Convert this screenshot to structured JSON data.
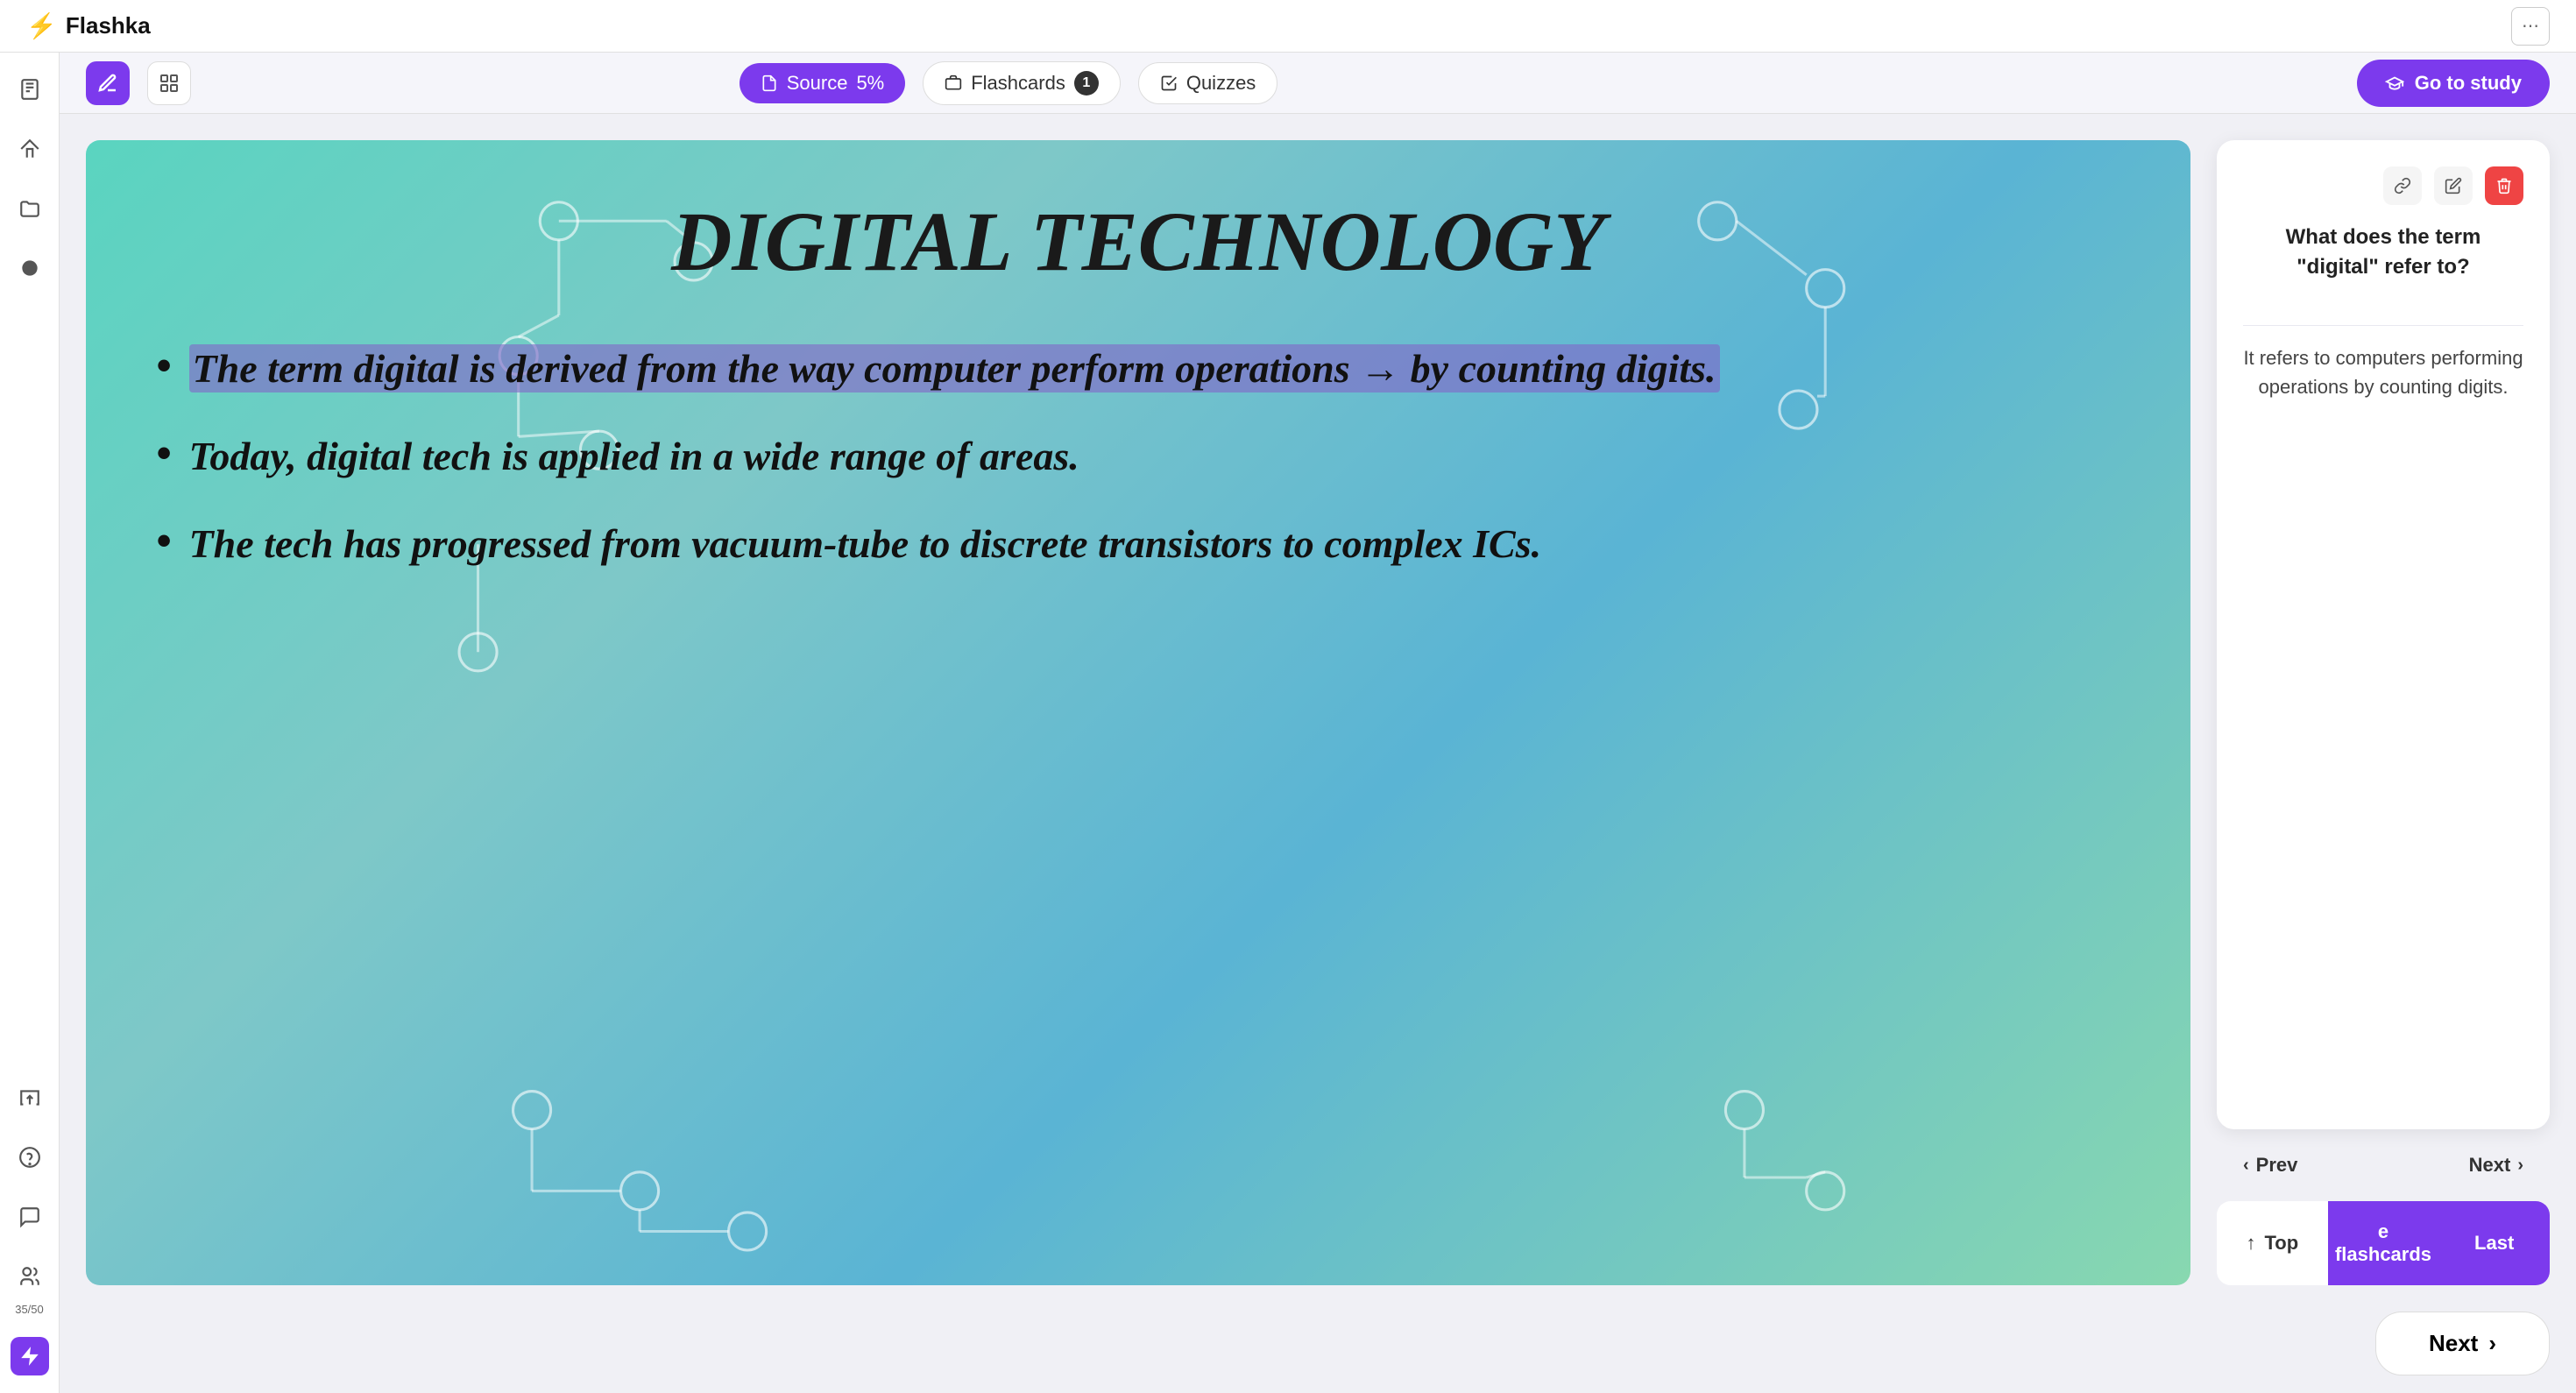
{
  "app": {
    "name": "Flashka",
    "logo_icon": "⚡"
  },
  "topbar": {
    "chat_icon": "💬"
  },
  "sidebar": {
    "items": [
      {
        "icon": "📄",
        "label": "document",
        "active": false
      },
      {
        "icon": "🏠",
        "label": "home",
        "active": false
      },
      {
        "icon": "📁",
        "label": "folder",
        "active": false
      },
      {
        "icon": "⚫",
        "label": "circle",
        "active": false
      },
      {
        "icon": "↗",
        "label": "export",
        "active": false
      },
      {
        "icon": "❓",
        "label": "help",
        "active": false
      },
      {
        "icon": "💬",
        "label": "chat",
        "active": false
      },
      {
        "icon": "👥",
        "label": "users",
        "active": false,
        "count": "35/50"
      },
      {
        "icon": "⚡",
        "label": "lightning",
        "active": true,
        "bottom": true
      }
    ]
  },
  "toolbar": {
    "tool_active_icon": "✏️",
    "tool_inactive_icon": "⊞",
    "source_label": "Source",
    "source_percent": "5%",
    "flashcards_label": "Flashcards",
    "flashcards_count": "1",
    "quizzes_label": "Quizzes",
    "go_to_study_label": "Go to study",
    "go_to_study_icon": "🎓"
  },
  "slide": {
    "title": "DIGITAL TECHNOLOGY",
    "bullets": [
      {
        "text_parts": [
          {
            "text": "The term digital is derived from the way computer perform operations → by counting digits.",
            "highlighted": true
          }
        ]
      },
      {
        "text_parts": [
          {
            "text": "Today, digital tech is applied in a wide range of areas.",
            "highlighted": false
          }
        ]
      },
      {
        "text_parts": [
          {
            "text": "The tech has progressed from vacuum-tube to discrete transistors to complex ICs.",
            "highlighted": false
          }
        ]
      }
    ]
  },
  "flashcard": {
    "question": "What does the term \"digital\" refer to?",
    "answer": "It refers to computers performing operations by counting digits.",
    "actions": {
      "link_title": "Link",
      "edit_title": "Edit",
      "delete_title": "Delete"
    }
  },
  "flashcard_nav": {
    "prev_label": "Prev",
    "next_label": "Next",
    "top_label": "Top",
    "flashcards_label": "e flashcards",
    "last_label": "Last",
    "top_icon": "↑",
    "prev_icon": "‹",
    "next_icon": "›"
  },
  "bottom_bar": {
    "next_label": "Next",
    "next_icon": "›"
  }
}
